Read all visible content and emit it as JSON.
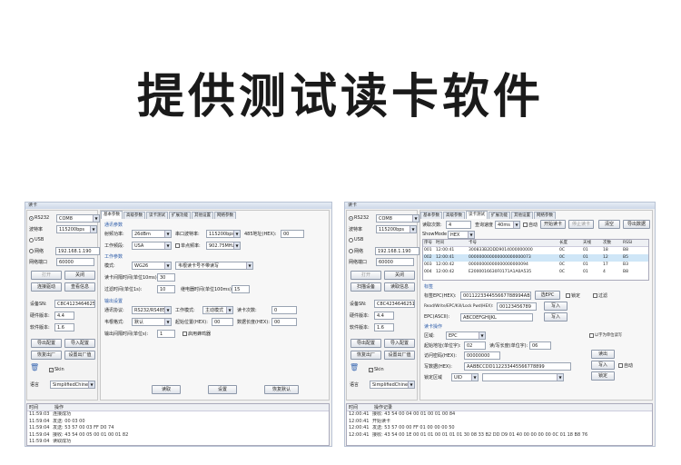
{
  "headline": "提供测试读卡软件",
  "left": {
    "title": "读卡",
    "side": {
      "group_title": "读卡",
      "rs232_label": "RS232",
      "rs232_value": "COM8",
      "baud_label": "波特率",
      "baud_value": "115200bps",
      "usb_label": "USB",
      "net_label": "网络",
      "ip": "192.168.1.190",
      "port_label": "网络端口",
      "port_value": "60000",
      "open_btn": "打开",
      "close_btn": "关闭",
      "scan_btn": "连接驱动",
      "read_info_btn": "查看信息",
      "sn_label": "设备SN:",
      "sn_value": "C8C41234646251",
      "hw_label": "硬件版本:",
      "hw_value": "4.4",
      "sw_label": "软件版本:",
      "sw_value": "1.6",
      "btn_import": "导出配置",
      "btn_export": "导入配置",
      "btn_restore": "恢复出厂",
      "btn_reboot": "设置出厂值",
      "skin_label": "Skin",
      "lang_label": "语言",
      "lang_value": "SimplifiedChine"
    },
    "tabs": [
      "基本参数",
      "高级参数",
      "读卡测试",
      "扩展功能",
      "其他设置",
      "网络参数"
    ],
    "main": {
      "sec1_title": "通讯参数",
      "power_label": "射频功率:",
      "power_value": "26dBm",
      "serial_label": "串口波特率:",
      "serial_value": "115200bps",
      "addr_label": "485地址(HEX):",
      "addr_value": "00",
      "band_label": "工作频段:",
      "band_value": "USA",
      "freq_label": "单点频率:",
      "freq_value": "902.75MHz",
      "sec2_title": "工作参数",
      "mode_label": "模式:",
      "mode_value": "WG26",
      "mode_desc": "韦根读卡号不带读写",
      "interval_label": "读卡间隔时间(单位10ms):",
      "interval_value": "30",
      "filter_label": "过滤时间(单位1s):",
      "filter_value": "10",
      "delay_label": "继电器时间(单位100ms):",
      "delay_value": "15",
      "sec3_title": "输出设置",
      "out_proto_label": "通讯协议:",
      "out_proto_value": "RS232/RS485",
      "work_mode_label": "工作模式:",
      "work_mode_value": "主动模式",
      "trig_label": "读卡次数:",
      "trig_value": "0",
      "wg_label": "韦根格式:",
      "wg_value": "默认",
      "start_label": "起始位置(HEX):",
      "start_value": "00",
      "len_label": "数据长度(HEX):",
      "len_value": "00",
      "buzz_label": "输出间隔时间(单位s):",
      "buzz_value": "1",
      "buzz_check": "启用蜂鸣器",
      "btn_read": "读取",
      "btn_set": "设置",
      "btn_default": "恢复默认"
    },
    "log": {
      "col_time": "时间",
      "col_msg": "操作",
      "rows": [
        {
          "t": "11:59:03",
          "m": "连接成功"
        },
        {
          "t": "11:59:04",
          "m": "发送: 00 03 00"
        },
        {
          "t": "11:59:04",
          "m": "发送: 53 57 00 03 FF D0 74"
        },
        {
          "t": "11:59:04",
          "m": "接收: 43 54 00 05 00 01 00 01 82"
        },
        {
          "t": "11:59:04",
          "m": "读取成功"
        }
      ]
    }
  },
  "right": {
    "title": "读卡",
    "side": {
      "rs232_label": "RS232",
      "rs232_value": "COM8",
      "baud_label": "波特率",
      "baud_value": "115200bps",
      "usb_label": "USB",
      "net_label": "网络",
      "ip": "192.168.1.190",
      "port_label": "网络端口",
      "port_value": "60000",
      "open_btn": "打开",
      "close_btn": "关闭",
      "scan_btn": "扫描设备",
      "read_info_btn": "读取信息",
      "sn_label": "设备SN:",
      "sn_value": "C8C4234646251",
      "hw_label": "硬件版本:",
      "hw_value": "4.4",
      "sw_label": "软件版本:",
      "sw_value": "1.6",
      "btn_import": "导出配置",
      "btn_export": "导入配置",
      "btn_restore": "恢复出厂",
      "btn_reboot": "设置出厂值",
      "skin_label": "Skin",
      "lang_label": "语言",
      "lang_value": "SimplifiedChine"
    },
    "tabs": [
      "基本参数",
      "高级参数",
      "读卡测试",
      "扩展功能",
      "其他设置",
      "网络参数"
    ],
    "main": {
      "count_label": "读取次数:",
      "count_value": "4",
      "speed_label": "查询速度",
      "speed_value": "40ms",
      "auto_label": "自动",
      "btn_start": "开始读卡",
      "btn_stop": "停止读卡",
      "btn_clear": "清空",
      "btn_save": "导出数据",
      "show_label": "ShowMode",
      "show_value": "HEX",
      "table_head": [
        "序号",
        "时间",
        "卡号",
        "长度",
        "天线",
        "次数",
        "RSSI"
      ],
      "table_rows": [
        [
          "001",
          "12:00:41",
          "300833B2DDD9014000000000",
          "0C",
          "01",
          "18",
          "B8"
        ],
        [
          "002",
          "12:00:41",
          "000000000000000000000073",
          "0C",
          "01",
          "12",
          "B5"
        ],
        [
          "003",
          "12:00:42",
          "00000000000000000000094",
          "0C",
          "01",
          "17",
          "B3"
        ],
        [
          "004",
          "12:00:42",
          "E2000016630F0171A1A0A535",
          "0C",
          "01",
          "4",
          "B8"
        ]
      ],
      "sec_title": "标签",
      "epc_label": "标签EPC(HEX):",
      "epc_value": "001122334455667788994ABB",
      "btn_sel_epc": "选EPC",
      "lock_check": "锁定",
      "filter_check": "过滤",
      "pwd_label": "Read/Write/EPC/Kill/Lock Pwd(HEX):",
      "pwd_value": "00123456789",
      "btn_write": "写入",
      "epcdata_label": "EPC(ASCII):",
      "epcdata_value": "ABCDEFGHIJKL",
      "btn_write2": "写入",
      "sec2_title": "读卡操作",
      "area_label": "区域:",
      "area_value": "EPC",
      "start_label": "起始地址(单位字):",
      "start_value": "02",
      "len_label": "读/写长度(单位字):",
      "len_value": "06",
      "pass_label": "访问密码(HEX):",
      "pass_value": "00000000",
      "data_label": "写数据(HEX):",
      "data_value": "AABBCCDD112233445566778899",
      "btn_read": "读出",
      "btn_write3": "写入",
      "btn_kill": "锁定",
      "check_word": "以字为单位读写",
      "check_auto": "自动",
      "lock_area_label": "锁定区域",
      "lock_area_value": "UID",
      "btn_lock": "锁定"
    },
    "log": {
      "col_time": "时间",
      "col_msg": "操作记录",
      "rows": [
        {
          "t": "12:00:41",
          "m": "接收: 43 54 00 04 00 01 00 01 00 84"
        },
        {
          "t": "12:00:41",
          "m": "开始读卡"
        },
        {
          "t": "12:00:41",
          "m": "发送: 53 57 00 00 FF 01 00 00 00 50"
        },
        {
          "t": "12:00:41",
          "m": "接收: 43 54 00 1E 00 01 01 00 01 01 01 30 08 33 B2 DD D9 01 40 00 00 00 00 0C 01 18 B8 76"
        }
      ]
    }
  }
}
